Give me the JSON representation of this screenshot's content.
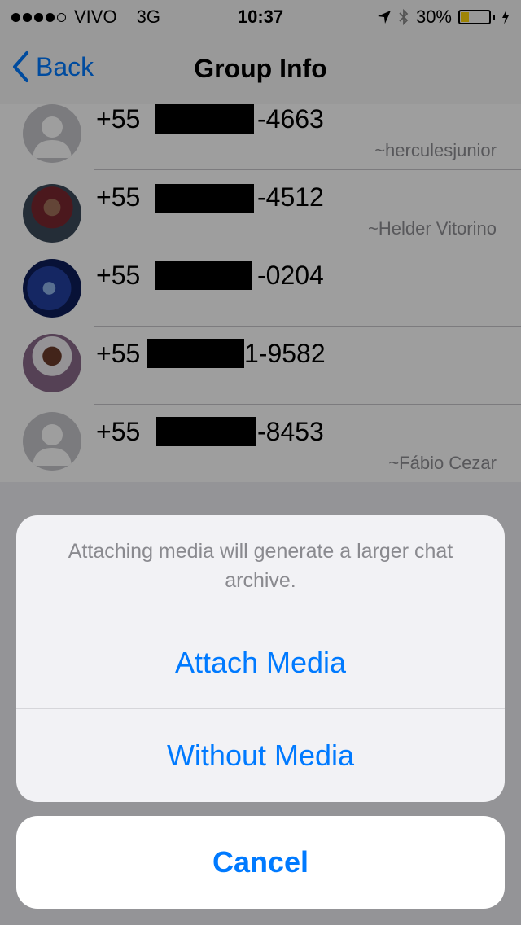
{
  "status_bar": {
    "carrier": "VIVO",
    "network": "3G",
    "time": "10:37",
    "battery_text": "30%",
    "battery_level": 0.3,
    "signal_bars_filled": 4,
    "signal_bars_total": 5
  },
  "nav": {
    "back_label": "Back",
    "title": "Group Info"
  },
  "participants": [
    {
      "phone_prefix": "+55",
      "phone_suffix": "-4663",
      "alias": "~herculesjunior"
    },
    {
      "phone_prefix": "+55",
      "phone_suffix": "-4512",
      "alias": "~Helder Vitorino"
    },
    {
      "phone_prefix": "+55",
      "phone_suffix": "-0204",
      "alias": ""
    },
    {
      "phone_prefix": "+55",
      "phone_suffix": "1-9582",
      "alias": ""
    },
    {
      "phone_prefix": "+55",
      "phone_suffix": "-8453",
      "alias": "~Fábio Cezar"
    }
  ],
  "action_sheet": {
    "message": "Attaching media will generate a larger chat archive.",
    "attach_label": "Attach Media",
    "without_label": "Without Media",
    "cancel_label": "Cancel"
  },
  "colors": {
    "accent": "#007aff",
    "battery": "#ffd60a"
  }
}
